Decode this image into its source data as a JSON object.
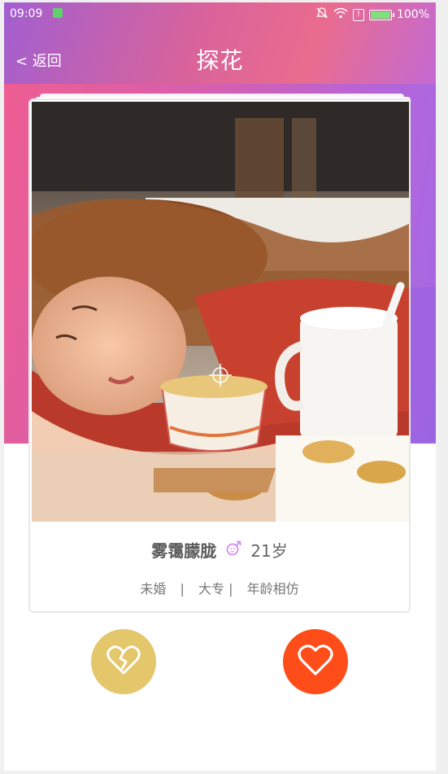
{
  "status_bar": {
    "time": "09:09",
    "battery": "100%"
  },
  "nav": {
    "back_label": "< 返回",
    "title": "探花"
  },
  "profile": {
    "name": "雾霭朦胧",
    "age": "21岁",
    "gender_icon": "female-symbol-icon",
    "details": [
      "未婚",
      "|",
      "大专 |",
      "年龄相仿"
    ]
  },
  "actions": {
    "dislike_icon": "broken-heart-icon",
    "like_icon": "heart-icon"
  },
  "colors": {
    "like": "#ff4d1a",
    "dislike": "#e4c66b",
    "gender": "#d18cf2"
  }
}
